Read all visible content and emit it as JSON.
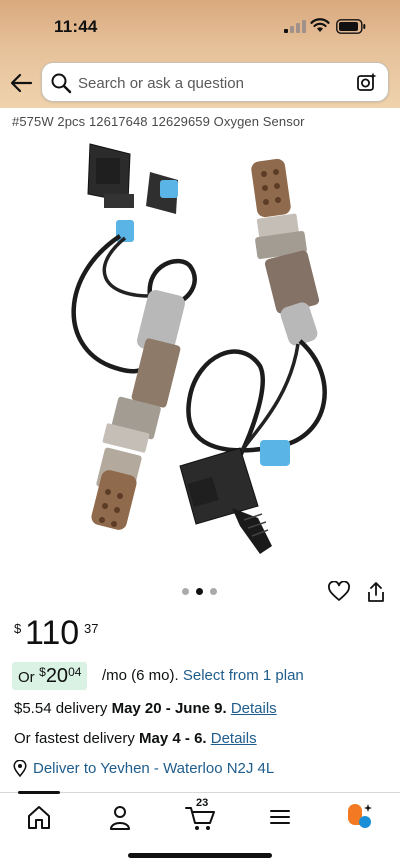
{
  "status_bar": {
    "time": "11:44"
  },
  "search": {
    "placeholder": "Search or ask a question"
  },
  "product": {
    "title": "#575W 2pcs 12617648 12629659 Oxygen Sensor",
    "image_count": 3,
    "active_image": 2
  },
  "price": {
    "currency": "$",
    "whole": "110",
    "fraction": "37"
  },
  "monthly": {
    "or_label": "Or",
    "currency": "$",
    "amount": "20",
    "fraction": "04",
    "term": "/mo (6 mo).",
    "plan_link": "Select from 1 plan"
  },
  "delivery": {
    "standard_prefix": "$5.54 delivery",
    "standard_dates": "May 20 - June 9.",
    "details_link": "Details",
    "fastest_prefix": "Or fastest delivery",
    "fastest_dates": "May 4 - 6.",
    "fastest_details_link": "Details"
  },
  "location": {
    "label": "Deliver to Yevhen - Waterloo N2J 4L"
  },
  "bottom_nav": {
    "cart_count": "23"
  },
  "colors": {
    "header_top": "#d9a97d",
    "link": "#1f5d8c",
    "badge_bg": "#d9f2e3"
  }
}
